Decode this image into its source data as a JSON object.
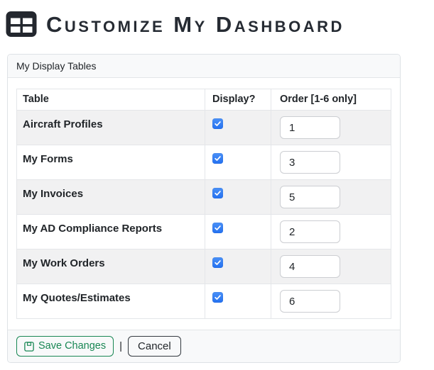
{
  "header": {
    "title": "Customize My Dashboard",
    "icon": "table-grid-icon"
  },
  "panel": {
    "title": "My Display Tables",
    "table": {
      "columns": [
        "Table",
        "Display?",
        "Order [1-6 only]"
      ],
      "rows": [
        {
          "name": "Aircraft Profiles",
          "display": true,
          "order": "1"
        },
        {
          "name": "My Forms",
          "display": true,
          "order": "3"
        },
        {
          "name": "My Invoices",
          "display": true,
          "order": "5"
        },
        {
          "name": "My AD Compliance Reports",
          "display": true,
          "order": "2"
        },
        {
          "name": "My Work Orders",
          "display": true,
          "order": "4"
        },
        {
          "name": "My Quotes/Estimates",
          "display": true,
          "order": "6"
        }
      ]
    },
    "footer": {
      "save_label": "Save Changes",
      "separator": "|",
      "cancel_label": "Cancel"
    }
  },
  "colors": {
    "title_text": "#262b33",
    "checkbox_blue": "#2f7cf3",
    "save_green": "#198754",
    "stripe_gray": "#f1f1f2",
    "panel_bg": "#f8f9fa",
    "border_gray": "#dee2e6"
  }
}
